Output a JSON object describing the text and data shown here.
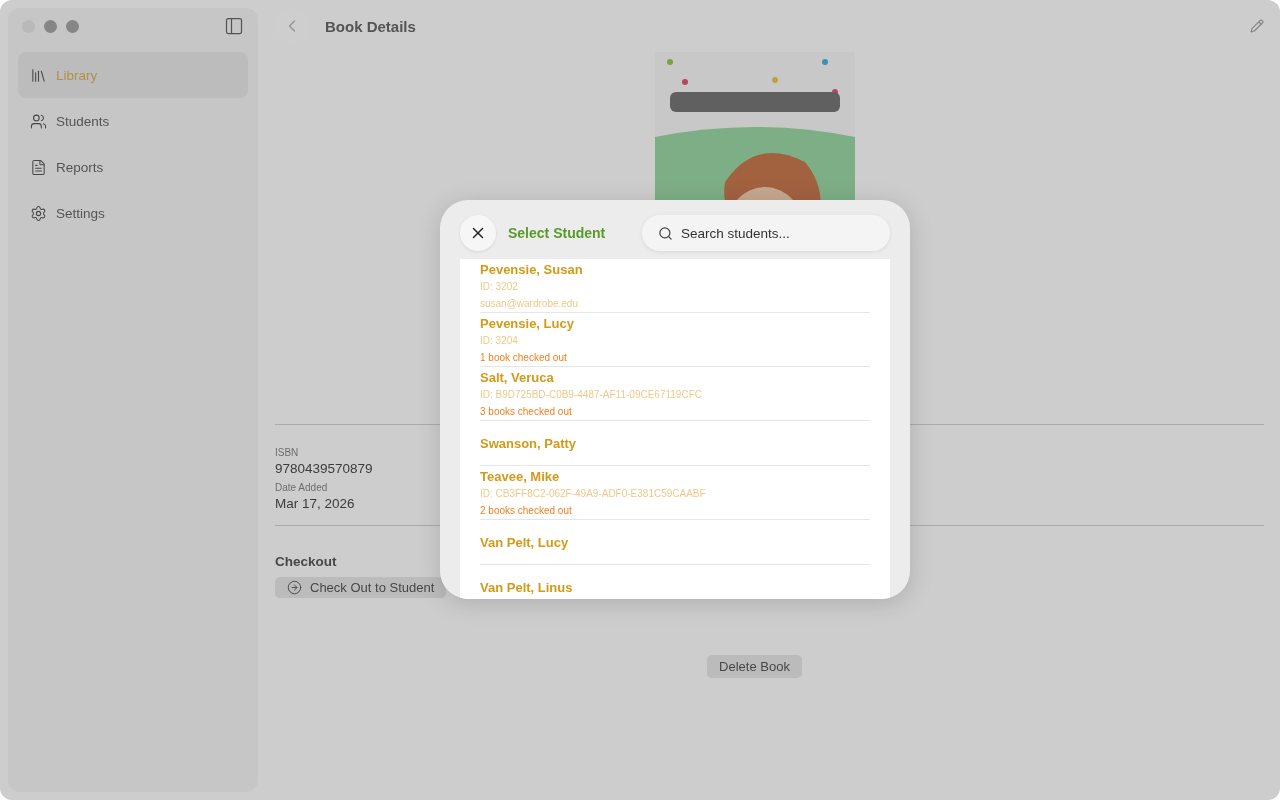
{
  "window": {
    "title": "Book Details"
  },
  "sidebar": {
    "items": [
      {
        "label": "Library",
        "selected": true
      },
      {
        "label": "Students",
        "selected": false
      },
      {
        "label": "Reports",
        "selected": false
      },
      {
        "label": "Settings",
        "selected": false
      }
    ]
  },
  "book": {
    "fields": [
      {
        "label": "ISBN",
        "value": "9780439570879"
      },
      {
        "label": "Date Added",
        "value": "Mar 17, 2026"
      }
    ],
    "checkout": {
      "heading": "Checkout",
      "button": "Check Out to Student"
    },
    "delete_button": "Delete Book"
  },
  "dialog": {
    "title": "Select Student",
    "search": {
      "placeholder": "Search students..."
    },
    "students": [
      {
        "name": "Pevensie, Susan",
        "id": "ID: 3202",
        "email": "susan@wardrobe.edu"
      },
      {
        "name": "Pevensie, Lucy",
        "id": "ID: 3204",
        "checkouts": "1 book checked out"
      },
      {
        "name": "Salt, Veruca",
        "id": "ID: B9D725BD-C0B9-4487-AF11-09CE67119CFC",
        "checkouts": "3 books checked out"
      },
      {
        "name": "Swanson, Patty"
      },
      {
        "name": "Teavee, Mike",
        "id": "ID: CB3FF8C2-062F-49A9-ADF0-E381C59CAABF",
        "checkouts": "2 books checked out"
      },
      {
        "name": "Van Pelt, Lucy"
      },
      {
        "name": "Van Pelt, Linus"
      }
    ]
  }
}
